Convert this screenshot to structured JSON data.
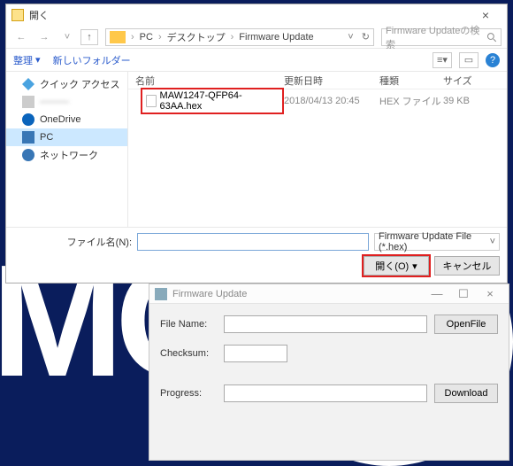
{
  "dialog1": {
    "title": "開く",
    "crumbs": [
      "PC",
      "デスクトップ",
      "Firmware Update"
    ],
    "search_placeholder": "Firmware Updateの検索",
    "toolbar": {
      "organize": "整理",
      "newfolder": "新しいフォルダー"
    },
    "sidebar": {
      "quick": "クイック アクセス",
      "redacted": "———",
      "onedrive": "OneDrive",
      "pc": "PC",
      "network": "ネットワーク"
    },
    "columns": {
      "name": "名前",
      "date": "更新日時",
      "type": "種類",
      "size": "サイズ"
    },
    "file": {
      "name": "MAW1247-QFP64-63AA.hex",
      "date": "2018/04/13 20:45",
      "type": "HEX ファイル",
      "size": "39 KB"
    },
    "filename_label": "ファイル名(N):",
    "filter": "Firmware Update File (*.hex)",
    "open_btn": "開く(O)",
    "cancel_btn": "キャンセル"
  },
  "dialog2": {
    "title": "Firmware Update",
    "filename_label": "File Name:",
    "checksum_label": "Checksum:",
    "progress_label": "Progress:",
    "openfile_btn": "OpenFile",
    "download_btn": "Download"
  }
}
